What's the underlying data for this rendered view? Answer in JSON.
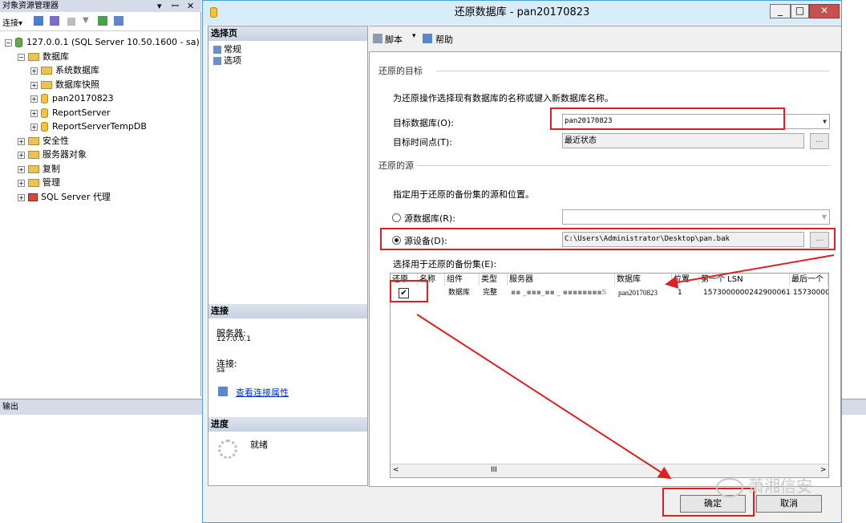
{
  "object_explorer": {
    "title": "对象资源管理器",
    "pin": "▾ ꟷ ✕",
    "toolbar_connect": "连接▾",
    "tree": [
      {
        "label": "127.0.0.1 (SQL Server 10.50.1600 - sa)",
        "level": 0,
        "kind": "server",
        "exp": "⊟"
      },
      {
        "label": "数据库",
        "level": 1,
        "kind": "folder",
        "exp": "⊟"
      },
      {
        "label": "系统数据库",
        "level": 2,
        "kind": "folder",
        "exp": "⊞"
      },
      {
        "label": "数据库快照",
        "level": 2,
        "kind": "folder",
        "exp": "⊞"
      },
      {
        "label": "pan20170823",
        "level": 2,
        "kind": "db",
        "exp": "⊞"
      },
      {
        "label": "ReportServer",
        "level": 2,
        "kind": "db",
        "exp": "⊞"
      },
      {
        "label": "ReportServerTempDB",
        "level": 2,
        "kind": "db",
        "exp": "⊞"
      },
      {
        "label": "安全性",
        "level": 1,
        "kind": "folder",
        "exp": "⊞"
      },
      {
        "label": "服务器对象",
        "level": 1,
        "kind": "folder",
        "exp": "⊞"
      },
      {
        "label": "复制",
        "level": 1,
        "kind": "folder",
        "exp": "⊞"
      },
      {
        "label": "管理",
        "level": 1,
        "kind": "folder",
        "exp": "⊞"
      },
      {
        "label": "SQL Server 代理",
        "level": 1,
        "kind": "agent",
        "exp": "⊞"
      }
    ]
  },
  "output": {
    "title": "输出"
  },
  "dialog": {
    "title": "还原数据库 - pan20170823",
    "select_page_header": "选择页",
    "pages": [
      "常规",
      "选项"
    ],
    "connection_header": "连接",
    "server_label": "服务器:",
    "server_value": "127.0.0.1",
    "connection_label": "连接:",
    "connection_value": "sa",
    "view_conn_props": "查看连接属性",
    "progress_header": "进度",
    "progress_status": "就绪",
    "toolbar": {
      "script": "脚本",
      "help": "帮助"
    },
    "target": {
      "group": "还原的目标",
      "desc": "为还原操作选择现有数据库的名称或键入新数据库名称。",
      "db_label": "目标数据库(O):",
      "db_value": "pan20170823",
      "time_label": "目标时间点(T):",
      "time_value": "最近状态",
      "ellipsis": "..."
    },
    "source": {
      "group": "还原的源",
      "desc": "指定用于还原的备份集的源和位置。",
      "from_db_label": "源数据库(R):",
      "from_device_label": "源设备(D):",
      "device_path": "C:\\Users\\Administrator\\Desktop\\pan.bak"
    },
    "backupsets": {
      "label": "选择用于还原的备份集(E):",
      "columns": [
        "还原",
        "名称",
        "组件",
        "类型",
        "服务器",
        "数据库",
        "位置",
        "第一个 LSN",
        "最后一个"
      ],
      "row": {
        "component": "数据库",
        "type": "完整",
        "server": "▪▪ _▪▪▪_▪▪ _ ▪▪▪▪▪▪▪▪S",
        "database": "pan20170823",
        "position": "1",
        "first_lsn": "1573000000242900061",
        "last_lsn": "157300000"
      }
    },
    "buttons": {
      "ok": "确定",
      "cancel": "取消"
    }
  },
  "watermark": "萧湘信安",
  "colors": {
    "annotation_red": "#e02020",
    "title_bar": "#d8ecf9"
  }
}
